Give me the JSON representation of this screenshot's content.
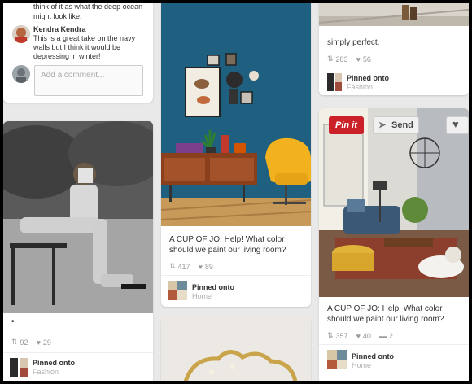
{
  "col1": {
    "top_comment_text": "think of it as what the deep ocean might look like.",
    "commenter_name": "Kendra Kendra",
    "comment_text": "This is a great take on the navy walls but I think it would be depressing in winter!",
    "comment_placeholder": "Add a comment...",
    "card2": {
      "description": "•",
      "repins": "92",
      "likes": "29",
      "pinned_onto": "Pinned onto",
      "board": "Fashion"
    }
  },
  "col2": {
    "card1": {
      "description": "A CUP OF JO: Help! What color should we paint our living room?",
      "repins": "417",
      "likes": "89",
      "pinned_onto": "Pinned onto",
      "board": "Home"
    }
  },
  "col3": {
    "card1": {
      "description": "simply perfect.",
      "repins": "283",
      "likes": "56",
      "pinned_onto": "Pinned onto",
      "board": "Fashion"
    },
    "card2": {
      "pinit_label": "Pin it",
      "send_label": "Send",
      "description": "A CUP OF JO: Help! What color should we paint our living room?",
      "repins": "357",
      "likes": "40",
      "comments": "2",
      "pinned_onto": "Pinned onto",
      "board": "Home"
    }
  },
  "colors": {
    "pinit_red": "#cb2027",
    "navy_wall": "#1f5f7f",
    "background": "#e9e9e9"
  }
}
